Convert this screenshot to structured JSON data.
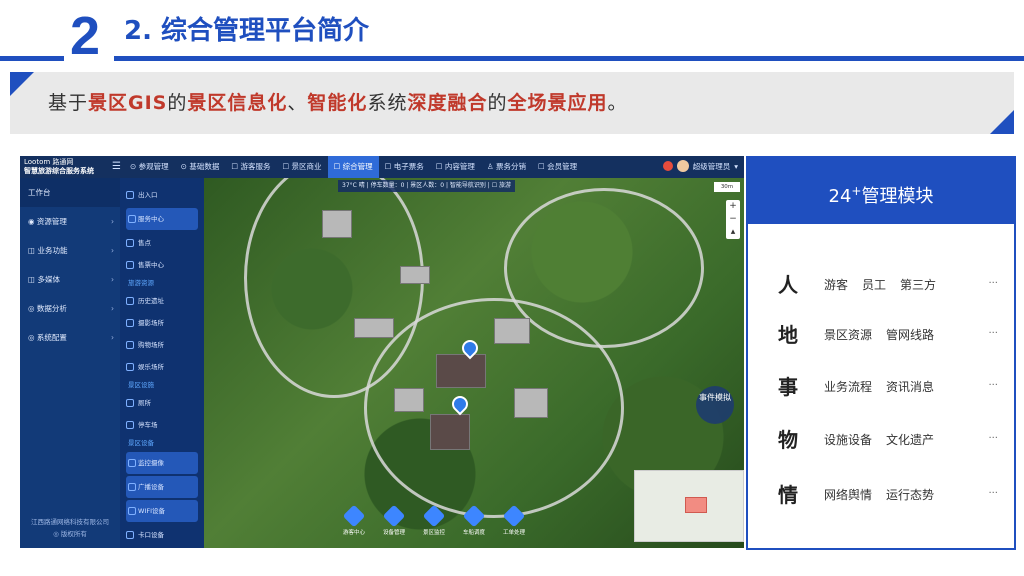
{
  "header": {
    "number": "2",
    "title": "2. 综合管理平台简介"
  },
  "banner": {
    "parts": [
      "基于",
      "景区GIS",
      "的",
      "景区信息化",
      "、",
      "智能化",
      "系统",
      "深度融合",
      "的",
      "全场景应用",
      "。"
    ]
  },
  "app": {
    "logo_line1": "Lootom 路通网",
    "logo_line2": "智慧旅游综合服务系统",
    "tabs": [
      {
        "label": "⊙ 参观管理",
        "active": false
      },
      {
        "label": "⊙ 基础数据",
        "active": false
      },
      {
        "label": "☐ 游客服务",
        "active": false
      },
      {
        "label": "☐ 景区商业",
        "active": false
      },
      {
        "label": "☐ 综合管理",
        "active": true
      },
      {
        "label": "☐ 电子票务",
        "active": false
      },
      {
        "label": "☐ 内容管理",
        "active": false
      },
      {
        "label": "♙ 票务分销",
        "active": false
      },
      {
        "label": "☐ 会员管理",
        "active": false
      }
    ],
    "user_name": "超级管理员",
    "sidebar": [
      {
        "label": "工作台",
        "chev": ""
      },
      {
        "label": "◉ 资源管理",
        "chev": "›"
      },
      {
        "label": "◫ 业务功能",
        "chev": "›"
      },
      {
        "label": "◫ 多媒体",
        "chev": "›"
      },
      {
        "label": "◎ 数据分析",
        "chev": "›"
      },
      {
        "label": "◎ 系统配置",
        "chev": "›"
      }
    ],
    "company": "江西路通网络科技有限公司",
    "version": "◎ 版权所有",
    "subpanel": [
      {
        "kind": "item",
        "label": "出入口",
        "active": false
      },
      {
        "kind": "item",
        "label": "服务中心",
        "active": true
      },
      {
        "kind": "item",
        "label": "售点",
        "active": false
      },
      {
        "kind": "item",
        "label": "售票中心",
        "active": false
      },
      {
        "kind": "head",
        "label": "旅游资源"
      },
      {
        "kind": "item",
        "label": "历史遗址",
        "active": false
      },
      {
        "kind": "item",
        "label": "摄影场所",
        "active": false
      },
      {
        "kind": "item",
        "label": "购物场所",
        "active": false
      },
      {
        "kind": "item",
        "label": "娱乐场所",
        "active": false
      },
      {
        "kind": "head",
        "label": "景区设施"
      },
      {
        "kind": "item",
        "label": "厕所",
        "active": false
      },
      {
        "kind": "item",
        "label": "停车场",
        "active": false
      },
      {
        "kind": "head",
        "label": "景区设备"
      },
      {
        "kind": "item",
        "label": "监控摄像",
        "active": true
      },
      {
        "kind": "item",
        "label": "广播设备",
        "active": true
      },
      {
        "kind": "item",
        "label": "WIFI设备",
        "active": true
      },
      {
        "kind": "item",
        "label": "卡口设备",
        "active": false
      }
    ],
    "map_status": "37°C 晴 | 停车数量：0 | 景区人数：0 | 智能导航识别 | ☐ 旅游",
    "scale": "30m",
    "event_button": "事件模拟",
    "dock": [
      "游客中心",
      "设备管理",
      "景区监控",
      "车船调度",
      "工单处理"
    ]
  },
  "panel": {
    "title": "24",
    "title_sup": "+",
    "title_rest": "管理模块",
    "rows": [
      {
        "big": "人",
        "items": [
          "游客",
          "员工",
          "第三方"
        ],
        "more": "···"
      },
      {
        "big": "地",
        "items": [
          "景区资源",
          "管网线路"
        ],
        "more": "···"
      },
      {
        "big": "事",
        "items": [
          "业务流程",
          "资讯消息"
        ],
        "more": "···"
      },
      {
        "big": "物",
        "items": [
          "设施设备",
          "文化遗产"
        ],
        "more": "···"
      },
      {
        "big": "情",
        "items": [
          "网络舆情",
          "运行态势"
        ],
        "more": "···"
      }
    ]
  },
  "colors": {
    "brand": "#1f4fbf",
    "highlight": "#c0392b",
    "active_tab": "#2f6bd8"
  }
}
